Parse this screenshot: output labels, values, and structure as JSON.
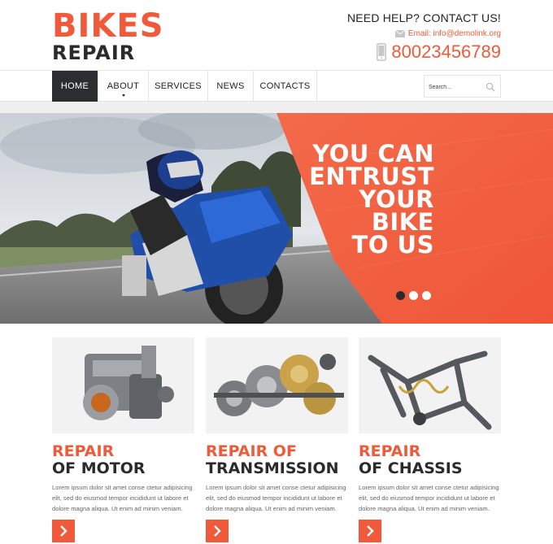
{
  "brand": {
    "line1": "BIKES",
    "line2": "REPAIR"
  },
  "help": {
    "title": "NEED HELP? CONTACT US!",
    "email": "Email: info@demolink.org",
    "phone": "80023456789"
  },
  "nav": {
    "items": [
      {
        "label": "HOME",
        "active": true
      },
      {
        "label": "ABOUT",
        "active": false
      },
      {
        "label": "SERVICES",
        "active": false
      },
      {
        "label": "NEWS",
        "active": false
      },
      {
        "label": "CONTACTS",
        "active": false
      }
    ],
    "search_placeholder": "Search..."
  },
  "hero": {
    "lines": [
      "YOU CAN",
      "ENTRUST",
      "YOUR",
      "BIKE",
      "TO US"
    ],
    "slides": 3,
    "active_slide": 1
  },
  "cards": [
    {
      "title1": "REPAIR",
      "title2": "OF MOTOR",
      "text": "Lorem ipsum dolor sit amet conse ctetur adipisicing elit, sed do eiusmod tempor incididunt ut labore et dolore magna aliqua. Ut enim ad minim veniam."
    },
    {
      "title1": "REPAIR OF",
      "title2": "TRANSMISSION",
      "text": "Lorem ipsum dolor sit amet conse ctetur adipisicing elit, sed do eiusmod tempor incididunt ut labore et dolore magna aliqua. Ut enim ad minim veniam."
    },
    {
      "title1": "REPAIR",
      "title2": "OF CHASSIS",
      "text": "Lorem ipsum dolor sit amet conse ctetur adipisicing elit, sed do eiusmod tempor incididunt ut labore et dolore magna aliqua. Ut enim ad minim veniam."
    }
  ],
  "colors": {
    "accent": "#f05a3a",
    "dark": "#2b2d31"
  },
  "icons": {
    "email": "envelope-icon",
    "phone": "phone-icon",
    "search": "search-icon",
    "more": "chevron-right-icon"
  }
}
